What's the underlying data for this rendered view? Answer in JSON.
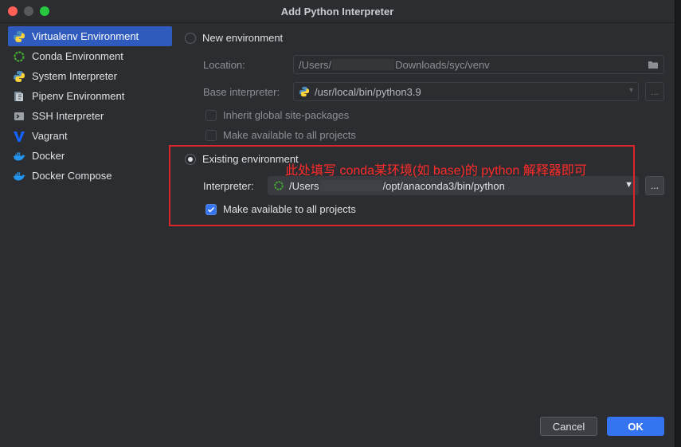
{
  "window": {
    "title": "Add Python Interpreter"
  },
  "sidebar": {
    "items": [
      {
        "label": "Virtualenv Environment",
        "icon": "virtualenv-icon",
        "selected": true
      },
      {
        "label": "Conda Environment",
        "icon": "conda-icon",
        "selected": false
      },
      {
        "label": "System Interpreter",
        "icon": "python-icon",
        "selected": false
      },
      {
        "label": "Pipenv Environment",
        "icon": "pipenv-icon",
        "selected": false
      },
      {
        "label": "SSH Interpreter",
        "icon": "ssh-icon",
        "selected": false
      },
      {
        "label": "Vagrant",
        "icon": "vagrant-icon",
        "selected": false
      },
      {
        "label": "Docker",
        "icon": "docker-icon",
        "selected": false
      },
      {
        "label": "Docker Compose",
        "icon": "docker-compose-icon",
        "selected": false
      }
    ]
  },
  "new_env": {
    "label": "New environment",
    "selected": false,
    "location_label": "Location:",
    "location_value_prefix": "/Users/",
    "location_value_suffix": "Downloads/syc/venv",
    "base_label": "Base interpreter:",
    "base_value": "/usr/local/bin/python3.9",
    "inherit_label": "Inherit global site-packages",
    "make_available_label": "Make available to all projects"
  },
  "existing_env": {
    "label": "Existing environment",
    "selected": true,
    "interpreter_label": "Interpreter:",
    "interpreter_prefix": "/Users",
    "interpreter_suffix": "/opt/anaconda3/bin/python",
    "make_available_label": "Make available to all projects",
    "make_available_checked": true
  },
  "annotation": {
    "text": "此处填写 conda某环境(如 base)的 python 解释器即可",
    "color": "#d9262b"
  },
  "buttons": {
    "browse": "...",
    "cancel": "Cancel",
    "ok": "OK"
  },
  "colors": {
    "accent": "#3574f0",
    "selected_item": "#2e5bbd",
    "background": "#2b2d30"
  }
}
